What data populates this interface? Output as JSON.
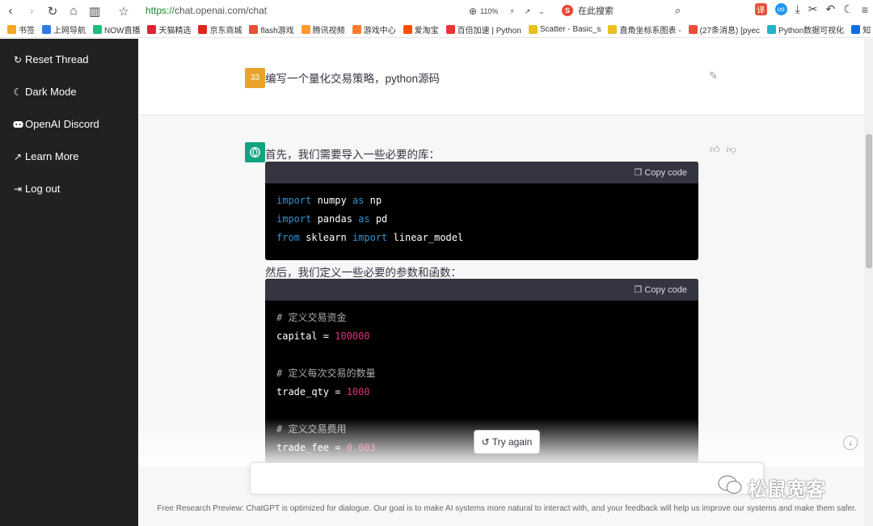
{
  "browser": {
    "url_scheme": "https://",
    "url_host": "chat.openai.com",
    "url_path": "/chat",
    "zoom": "110%",
    "search_label": "在此搜索"
  },
  "bookmarks": [
    {
      "label": "书签",
      "color": "#f5a623"
    },
    {
      "label": "上网导航",
      "color": "#2d7be5"
    },
    {
      "label": "NOW直播",
      "color": "#1cc07a"
    },
    {
      "label": "天猫精选",
      "color": "#e0223a"
    },
    {
      "label": "京东商城",
      "color": "#e1251b"
    },
    {
      "label": "flash游戏",
      "color": "#e8503a"
    },
    {
      "label": "腾讯视频",
      "color": "#ff9a2e"
    },
    {
      "label": "游戏中心",
      "color": "#ff7a2e"
    },
    {
      "label": "爱淘宝",
      "color": "#ff5000"
    },
    {
      "label": "百倍加速 | Python",
      "color": "#e33"
    },
    {
      "label": "Scatter - Basic_s",
      "color": "#e8c020"
    },
    {
      "label": "直角坐标系图表 -",
      "color": "#e8c020"
    },
    {
      "label": "(27条消息) [pyec",
      "color": "#e8503a"
    },
    {
      "label": "Python数据可视化",
      "color": "#20b4c8"
    },
    {
      "label": "知",
      "color": "#0e6fe3"
    }
  ],
  "sidebar": {
    "items": [
      {
        "label": "Reset Thread",
        "icon": "refresh-icon"
      },
      {
        "label": "Dark Mode",
        "icon": "moon-icon"
      },
      {
        "label": "OpenAI Discord",
        "icon": "discord-icon"
      },
      {
        "label": "Learn More",
        "icon": "external-link-icon"
      },
      {
        "label": "Log out",
        "icon": "logout-icon"
      }
    ]
  },
  "chat": {
    "user_avatar": "33",
    "user_message": "编写一个量化交易策略，python源码",
    "reply_intro": "首先，我们需要导入一些必要的库：",
    "reply_middle": "然后，我们定义一些必要的参数和函数：",
    "copy_label": "Copy code",
    "try_again": "Try again",
    "code1": [
      [
        {
          "t": "import",
          "c": "kw"
        },
        {
          "t": " numpy ",
          "c": ""
        },
        {
          "t": "as",
          "c": "kw"
        },
        {
          "t": " np",
          "c": ""
        }
      ],
      [
        {
          "t": "import",
          "c": "kw"
        },
        {
          "t": " pandas ",
          "c": ""
        },
        {
          "t": "as",
          "c": "kw"
        },
        {
          "t": " pd",
          "c": ""
        }
      ],
      [
        {
          "t": "from",
          "c": "kw"
        },
        {
          "t": " sklearn ",
          "c": ""
        },
        {
          "t": "import",
          "c": "kw"
        },
        {
          "t": " linear_model",
          "c": ""
        }
      ]
    ],
    "code2": [
      [
        {
          "t": "# 定义交易资金",
          "c": "cm"
        }
      ],
      [
        {
          "t": "capital = ",
          "c": ""
        },
        {
          "t": "100000",
          "c": "num"
        }
      ],
      [],
      [
        {
          "t": "# 定义每次交易的数量",
          "c": "cm"
        }
      ],
      [
        {
          "t": "trade_qty = ",
          "c": ""
        },
        {
          "t": "1000",
          "c": "num"
        }
      ],
      [],
      [
        {
          "t": "# 定义交易费用",
          "c": "cm"
        }
      ],
      [
        {
          "t": "trade_fee = ",
          "c": ""
        },
        {
          "t": "0.003",
          "c": "num"
        }
      ]
    ]
  },
  "footer_text": "Free Research Preview: ChatGPT is optimized for dialogue. Our goal is to make AI systems more natural to interact with, and your feedback will help us improve our systems and make them safer.",
  "watermark": "松鼠宽客"
}
